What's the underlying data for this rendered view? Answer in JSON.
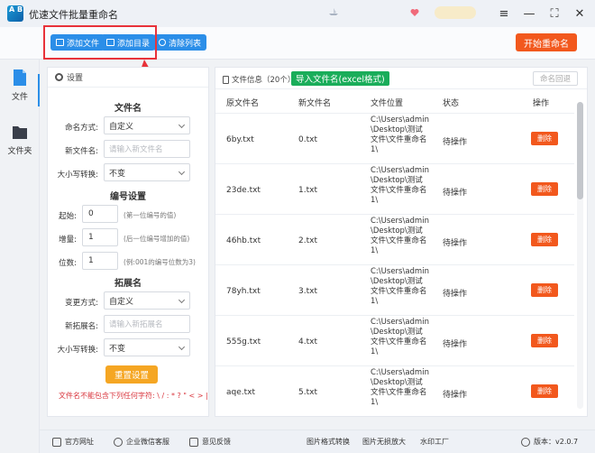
{
  "app": {
    "title": "优速文件批量重命名",
    "logo_text": "A B"
  },
  "toolbar": {
    "add_file": "添加文件",
    "add_folder": "添加目录",
    "clear_list": "清除列表",
    "start": "开始重命名"
  },
  "nav": {
    "file": "文件",
    "folder": "文件夹"
  },
  "settings": {
    "header": "设置",
    "filename_section": "文件名",
    "naming_mode_label": "命名方式:",
    "naming_mode_value": "自定义",
    "new_name_label": "新文件名:",
    "new_name_placeholder": "请输入新文件名",
    "case_label": "大小写转换:",
    "case_value": "不变",
    "numbering_section": "编号设置",
    "start_label": "起始:",
    "start_value": "0",
    "start_hint": "(第一位编号的值)",
    "step_label": "增量:",
    "step_value": "1",
    "step_hint": "(后一位编号增加的值)",
    "digits_label": "位数:",
    "digits_value": "1",
    "digits_hint": "(例:001的编号位数为3)",
    "ext_section": "拓展名",
    "ext_mode_label": "变更方式:",
    "ext_mode_value": "自定义",
    "new_ext_label": "新拓展名:",
    "new_ext_placeholder": "请输入新拓展名",
    "ext_case_label": "大小写转换:",
    "ext_case_value": "不变",
    "reset": "重置设置",
    "warning": "文件名不能包含下列任何字符: \\ / : * ? \" < > |"
  },
  "list": {
    "header": "文件信息（20个）",
    "import_btn": "导入文件名(excel格式)",
    "rollback": "命名回退",
    "columns": [
      "原文件名",
      "新文件名",
      "文件位置",
      "状态",
      "操作"
    ],
    "rows": [
      {
        "orig": "6by.txt",
        "new": "0.txt",
        "path": "C:\\Users\\admin\\Desktop\\测试文件\\文件重命名1\\",
        "status": "待操作",
        "action": "删除"
      },
      {
        "orig": "23de.txt",
        "new": "1.txt",
        "path": "C:\\Users\\admin\\Desktop\\测试文件\\文件重命名1\\",
        "status": "待操作",
        "action": "删除"
      },
      {
        "orig": "46hb.txt",
        "new": "2.txt",
        "path": "C:\\Users\\admin\\Desktop\\测试文件\\文件重命名1\\",
        "status": "待操作",
        "action": "删除"
      },
      {
        "orig": "78yh.txt",
        "new": "3.txt",
        "path": "C:\\Users\\admin\\Desktop\\测试文件\\文件重命名1\\",
        "status": "待操作",
        "action": "删除"
      },
      {
        "orig": "555g.txt",
        "new": "4.txt",
        "path": "C:\\Users\\admin\\Desktop\\测试文件\\文件重命名1\\",
        "status": "待操作",
        "action": "删除"
      },
      {
        "orig": "aqe.txt",
        "new": "5.txt",
        "path": "C:\\Users\\admin\\Desktop\\测试文件\\文件重命名1\\",
        "status": "待操作",
        "action": "删除"
      }
    ]
  },
  "footer": {
    "website": "官方网址",
    "wechat": "企业微信客服",
    "feedback": "意见反馈",
    "img_convert": "图片格式转换",
    "img_enlarge": "图片无损放大",
    "watermark": "水印工厂",
    "version": "版本：v2.0.7"
  }
}
